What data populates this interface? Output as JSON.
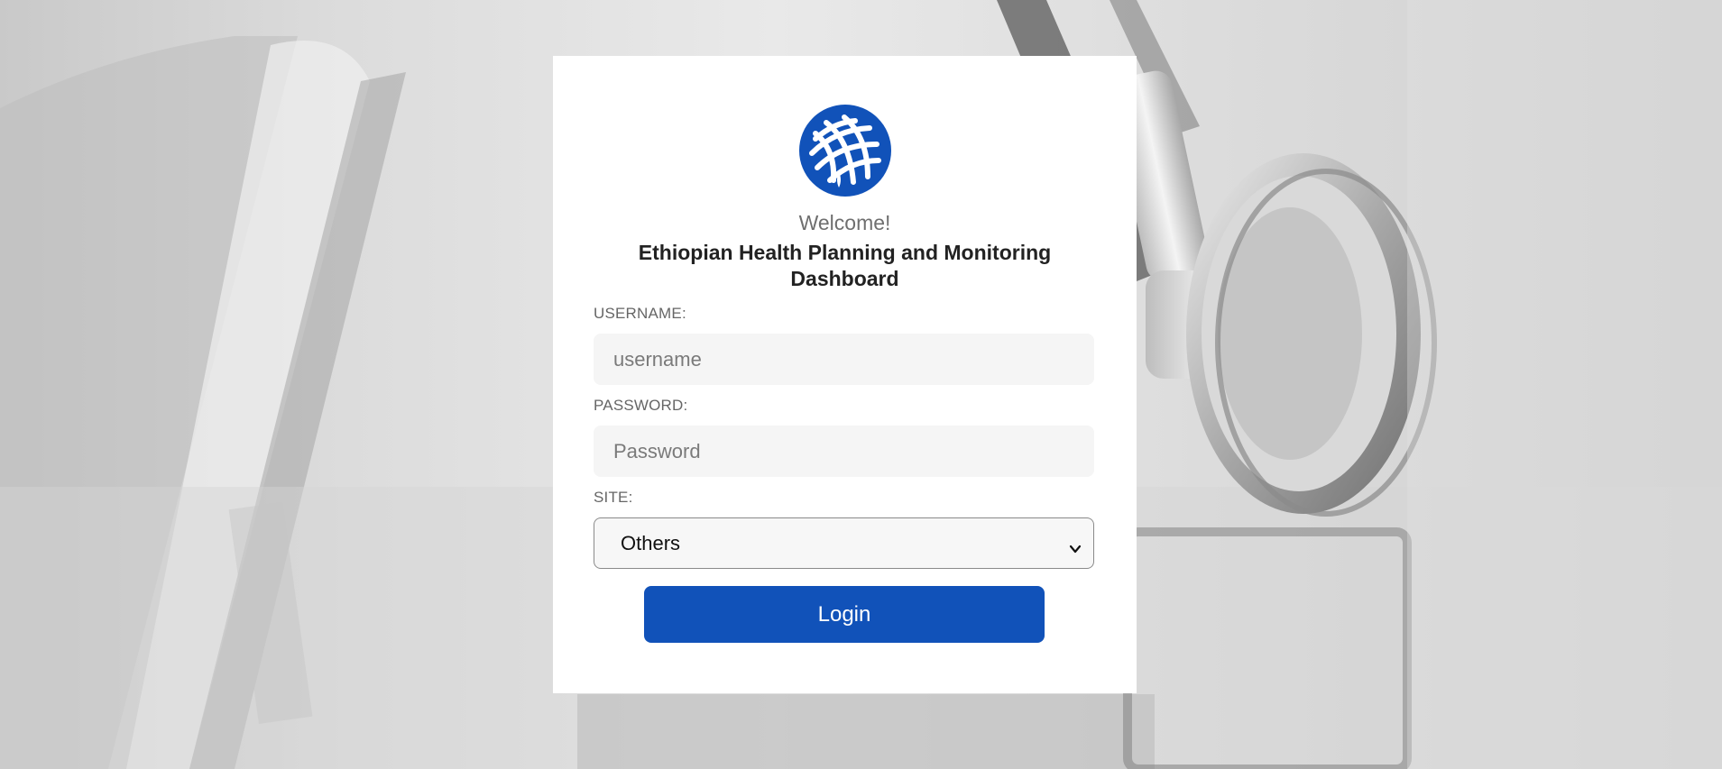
{
  "background": {
    "description_icon": "stethoscope-photo"
  },
  "logo": {
    "icon": "woven-emblem-icon",
    "color": "#1152b9"
  },
  "login": {
    "welcome": "Welcome!",
    "title": "Ethiopian Health Planning and Monitoring Dashboard",
    "username_label": "USERNAME:",
    "username_placeholder": "username",
    "username_value": "",
    "password_label": "PASSWORD:",
    "password_placeholder": "Password",
    "password_value": "",
    "site_label": "SITE:",
    "site_selected": "Others",
    "login_button": "Login"
  },
  "colors": {
    "accent": "#1152b9",
    "card": "#ffffff",
    "input_bg": "#f5f5f5"
  }
}
